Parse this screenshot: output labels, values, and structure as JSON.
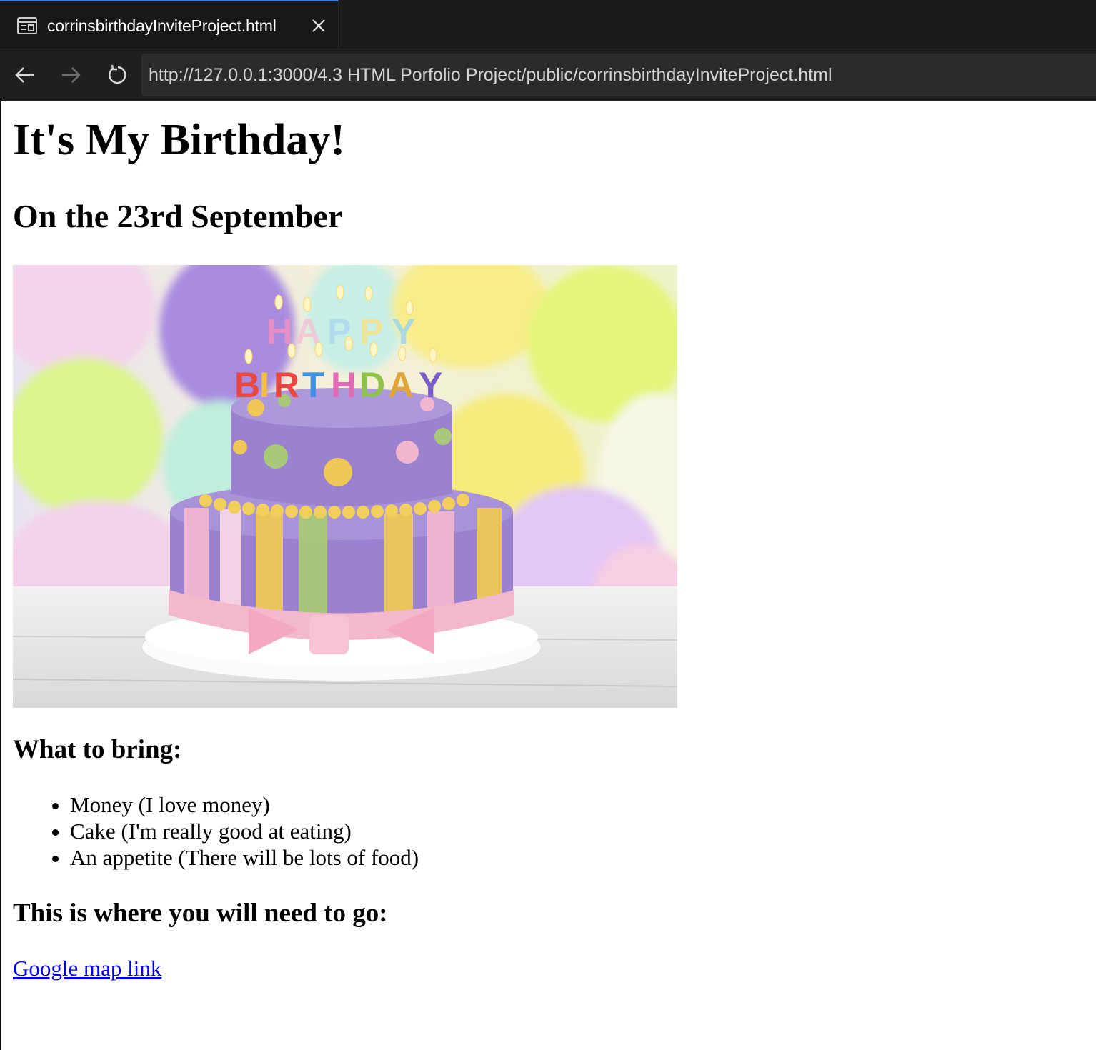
{
  "browser": {
    "tab": {
      "title": "corrinsbirthdayInviteProject.html",
      "icon": "preview-icon"
    },
    "url": "http://127.0.0.1:3000/4.3 HTML Porfolio Project/public/corrinsbirthdayInviteProject.html"
  },
  "page": {
    "title": "It's My Birthday!",
    "subtitle": "On the 23rd September",
    "image": {
      "candle_letters": [
        "H",
        "A",
        "P",
        "P",
        "Y",
        "B",
        "I",
        "R",
        "T",
        "H",
        "D",
        "A",
        "Y"
      ]
    },
    "bring_heading": "What to bring:",
    "bring_items": [
      "Money (I love money)",
      "Cake (I'm really good at eating)",
      "An appetite (There will be lots of food)"
    ],
    "where_heading": "This is where you will need to go:",
    "map_link": "Google map link"
  },
  "colors": {
    "tab_accent": "#3d7fd8",
    "link": "#0000ee",
    "cake_purple": "#9b82cf",
    "cake_yellow": "#f1c857",
    "cake_green": "#a9c97a",
    "cake_pink": "#f2b6cf"
  }
}
